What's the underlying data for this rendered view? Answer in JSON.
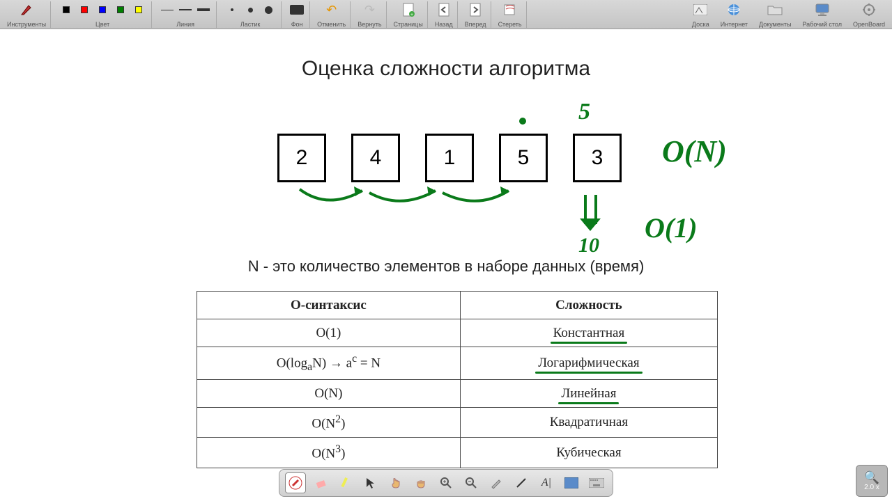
{
  "toolbar": {
    "tools_label": "Инструменты",
    "color_label": "Цвет",
    "line_label": "Линия",
    "eraser_label": "Ластик",
    "background_label": "Фон",
    "undo_label": "Отменить",
    "redo_label": "Вернуть",
    "pages_label": "Страницы",
    "back_label": "Назад",
    "forward_label": "Вперед",
    "erase_label": "Стереть",
    "board_label": "Доска",
    "internet_label": "Интернет",
    "documents_label": "Документы",
    "desktop_label": "Рабочий стол",
    "openboard_label": "OpenBoard",
    "colors": [
      "#000000",
      "#ff0000",
      "#0000ff",
      "#008000",
      "#ffff00"
    ]
  },
  "content": {
    "title": "Оценка сложности алгоритма",
    "boxes": [
      "2",
      "4",
      "1",
      "5",
      "3"
    ],
    "subtitle": "N - это количество элементов в наборе данных (время)",
    "annotations": {
      "dot_above": "·",
      "five_hand": "5",
      "on": "O(N)",
      "o1": "O(1)",
      "ten": "10"
    },
    "table": {
      "headers": [
        "О-синтаксис",
        "Сложность"
      ],
      "rows": [
        {
          "syntax": "O(1)",
          "complexity": "Константная",
          "underline": true
        },
        {
          "syntax_html": "O(log<sub>a</sub>N) → a<sup>c</sup> = N",
          "complexity": "Логарифмическая",
          "underline": true
        },
        {
          "syntax": "O(N)",
          "complexity": "Линейная",
          "underline": true
        },
        {
          "syntax_html": "O(N<sup>2</sup>)",
          "complexity": "Квадратичная",
          "underline": false
        },
        {
          "syntax_html": "O(N<sup>3</sup>)",
          "complexity": "Кубическая",
          "underline": false
        }
      ]
    }
  },
  "dock": {
    "items": [
      "pen",
      "eraser",
      "marker",
      "pointer",
      "hand",
      "grab",
      "zoom-in",
      "zoom-out",
      "laser",
      "line",
      "text",
      "capture",
      "keyboard"
    ]
  },
  "zoom": {
    "label": "2.0 x"
  }
}
